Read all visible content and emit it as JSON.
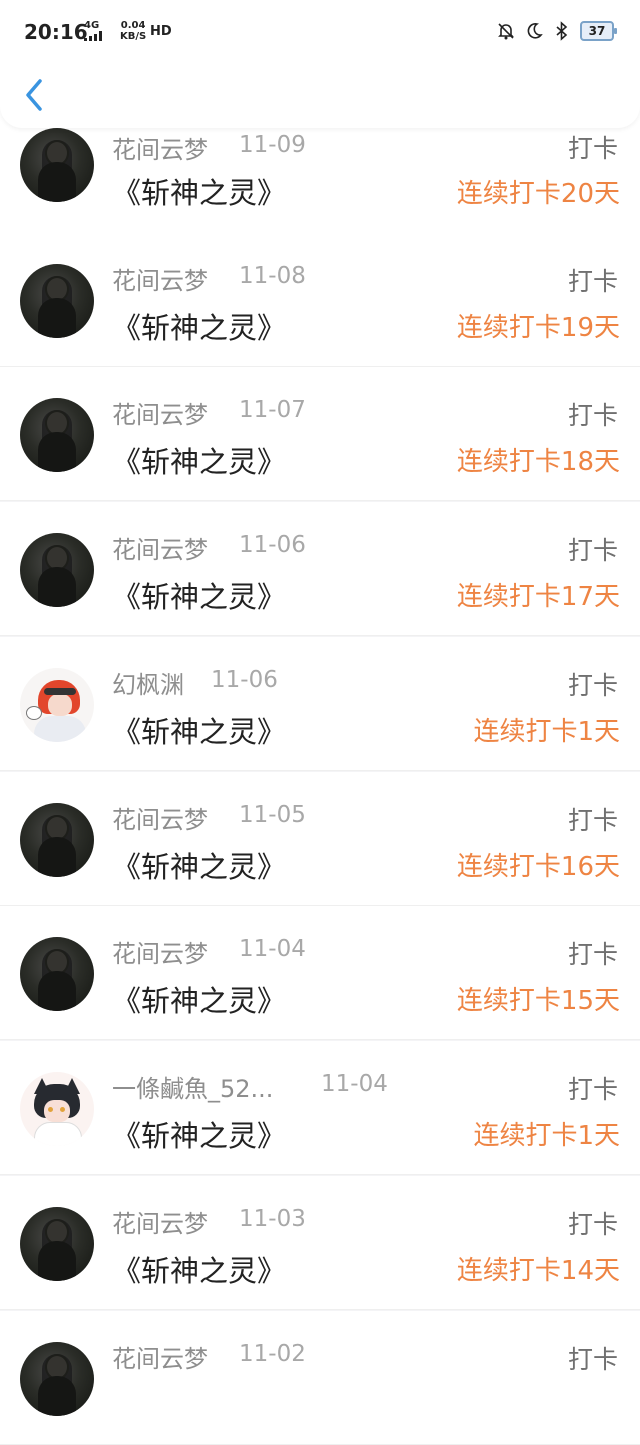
{
  "status_bar": {
    "time": "20:16",
    "network": "4G",
    "speed_value": "0.04",
    "speed_unit": "KB/S",
    "hd": "HD",
    "battery": "37"
  },
  "header": {
    "back_icon": "chevron-left-icon"
  },
  "colors": {
    "accent": "#ee8443",
    "back": "#3a94e0"
  },
  "items": [
    {
      "name": "花间云梦",
      "date": "11-09",
      "type": "打卡",
      "book": "《斩神之灵》",
      "streak": "连续打卡20天",
      "avatar": "dark"
    },
    {
      "name": "花间云梦",
      "date": "11-08",
      "type": "打卡",
      "book": "《斩神之灵》",
      "streak": "连续打卡19天",
      "avatar": "dark"
    },
    {
      "name": "花间云梦",
      "date": "11-07",
      "type": "打卡",
      "book": "《斩神之灵》",
      "streak": "连续打卡18天",
      "avatar": "dark"
    },
    {
      "name": "花间云梦",
      "date": "11-06",
      "type": "打卡",
      "book": "《斩神之灵》",
      "streak": "连续打卡17天",
      "avatar": "dark"
    },
    {
      "name": "幻枫渊",
      "date": "11-06",
      "type": "打卡",
      "book": "《斩神之灵》",
      "streak": "连续打卡1天",
      "avatar": "red"
    },
    {
      "name": "花间云梦",
      "date": "11-05",
      "type": "打卡",
      "book": "《斩神之灵》",
      "streak": "连续打卡16天",
      "avatar": "dark"
    },
    {
      "name": "花间云梦",
      "date": "11-04",
      "type": "打卡",
      "book": "《斩神之灵》",
      "streak": "连续打卡15天",
      "avatar": "dark"
    },
    {
      "name": "一條鹹魚_52...",
      "date": "11-04",
      "type": "打卡",
      "book": "《斩神之灵》",
      "streak": "连续打卡1天",
      "avatar": "cat"
    },
    {
      "name": "花间云梦",
      "date": "11-03",
      "type": "打卡",
      "book": "《斩神之灵》",
      "streak": "连续打卡14天",
      "avatar": "dark"
    },
    {
      "name": "花间云梦",
      "date": "11-02",
      "type": "打卡",
      "book": "",
      "streak": "",
      "avatar": "dark"
    }
  ]
}
